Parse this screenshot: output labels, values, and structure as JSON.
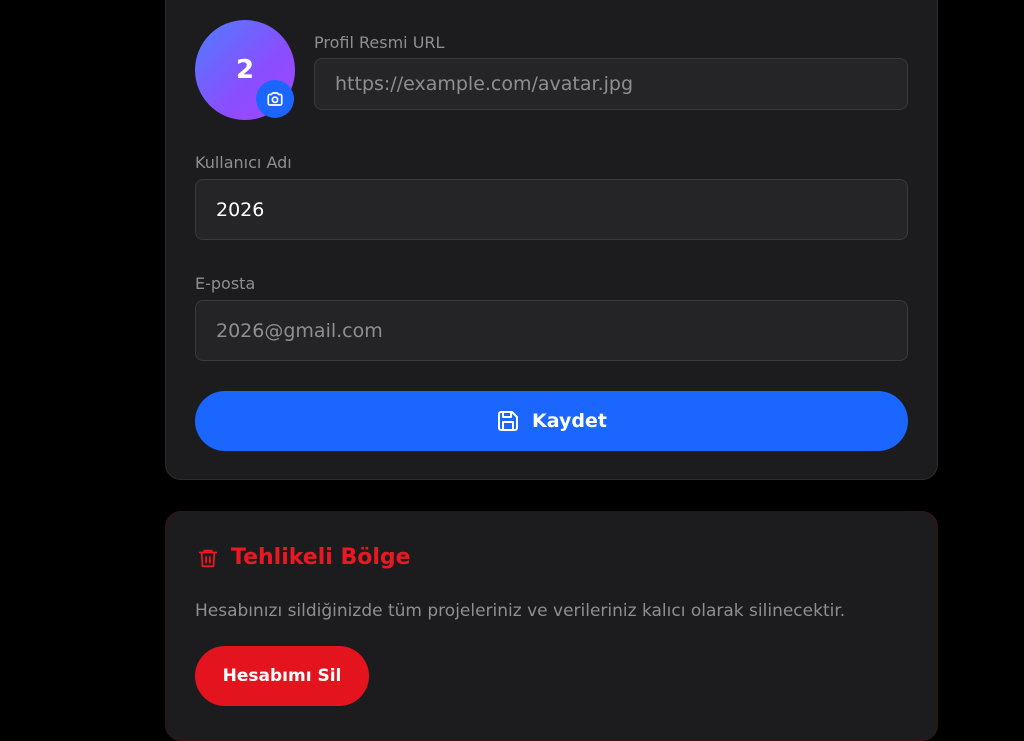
{
  "profile": {
    "avatar_initial": "2",
    "avatar_url_label": "Profil Resmi URL",
    "avatar_url_placeholder": "https://example.com/avatar.jpg",
    "username_label": "Kullanıcı Adı",
    "username_value": "2026",
    "email_label": "E-posta",
    "email_value": "2026@gmail.com",
    "save_label": "Kaydet"
  },
  "danger_zone": {
    "title": "Tehlikeli Bölge",
    "description": "Hesabınızı sildiğinizde tüm projeleriniz ve verileriniz kalıcı olarak silinecektir.",
    "delete_label": "Hesabımı Sil"
  },
  "icons": {
    "avatar_edit": "camera-icon",
    "save": "floppy-disk-icon",
    "danger": "trash-icon"
  },
  "colors": {
    "accent": "#1a66ff",
    "danger": "#e3141e",
    "card_background": "#1c1c1e",
    "page_background": "#000000"
  }
}
